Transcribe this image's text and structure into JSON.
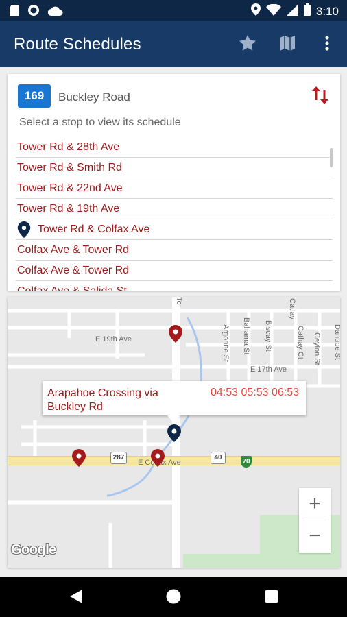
{
  "status_bar": {
    "time": "3:10",
    "icons_left": [
      "sd-card-icon",
      "sync-icon",
      "cloud-icon"
    ],
    "icons_right": [
      "location-icon",
      "wifi-icon",
      "signal-icon",
      "battery-icon"
    ]
  },
  "app_bar": {
    "title": "Route Schedules",
    "actions": [
      "star-icon",
      "map-icon",
      "more-vert-icon"
    ]
  },
  "route": {
    "number": "169",
    "name": "Buckley Road",
    "hint": "Select a stop to view its schedule",
    "stops": [
      {
        "label": "Tower Rd & 28th Ave",
        "selected": false
      },
      {
        "label": "Tower Rd & Smith Rd",
        "selected": false
      },
      {
        "label": "Tower Rd & 22nd Ave",
        "selected": false
      },
      {
        "label": "Tower Rd & 19th Ave",
        "selected": false
      },
      {
        "label": "Tower Rd & Colfax Ave",
        "selected": true
      },
      {
        "label": "Colfax Ave & Tower Rd",
        "selected": false
      },
      {
        "label": "Colfax Ave & Tower Rd",
        "selected": false
      },
      {
        "label": "Colfax Ave & Salida St",
        "selected": false
      }
    ]
  },
  "map": {
    "info_window": {
      "title": "Arapahoe Crossing via Buckley Rd",
      "times": "04:53 05:53 06:53"
    },
    "streets": {
      "e19th": "E 19th Ave",
      "e17th": "E 17th Ave",
      "colfax": "E Colfax Ave",
      "argonne": "Argonne St",
      "bahama": "Bahama St",
      "biscay": "Biscay St",
      "cathay": "Cathay Ct",
      "ceylon": "Ceylon St",
      "danube": "Danube St",
      "catlay": "Catlay",
      "tower": "To"
    },
    "shields": {
      "us287": "287",
      "us40": "40",
      "i70": "70"
    },
    "zoom_in": "+",
    "zoom_out": "−",
    "logo": "Google"
  },
  "colors": {
    "status_bar": "#0e2746",
    "app_bar": "#173a67",
    "route_badge": "#1976d2",
    "stop_text": "#9b1c1c",
    "times_text": "#e8493d",
    "selected_pin": "#0e2746",
    "map_pin": "#a31b1b"
  },
  "nav_bar": {
    "buttons": [
      "back-icon",
      "home-icon",
      "recents-icon"
    ]
  }
}
